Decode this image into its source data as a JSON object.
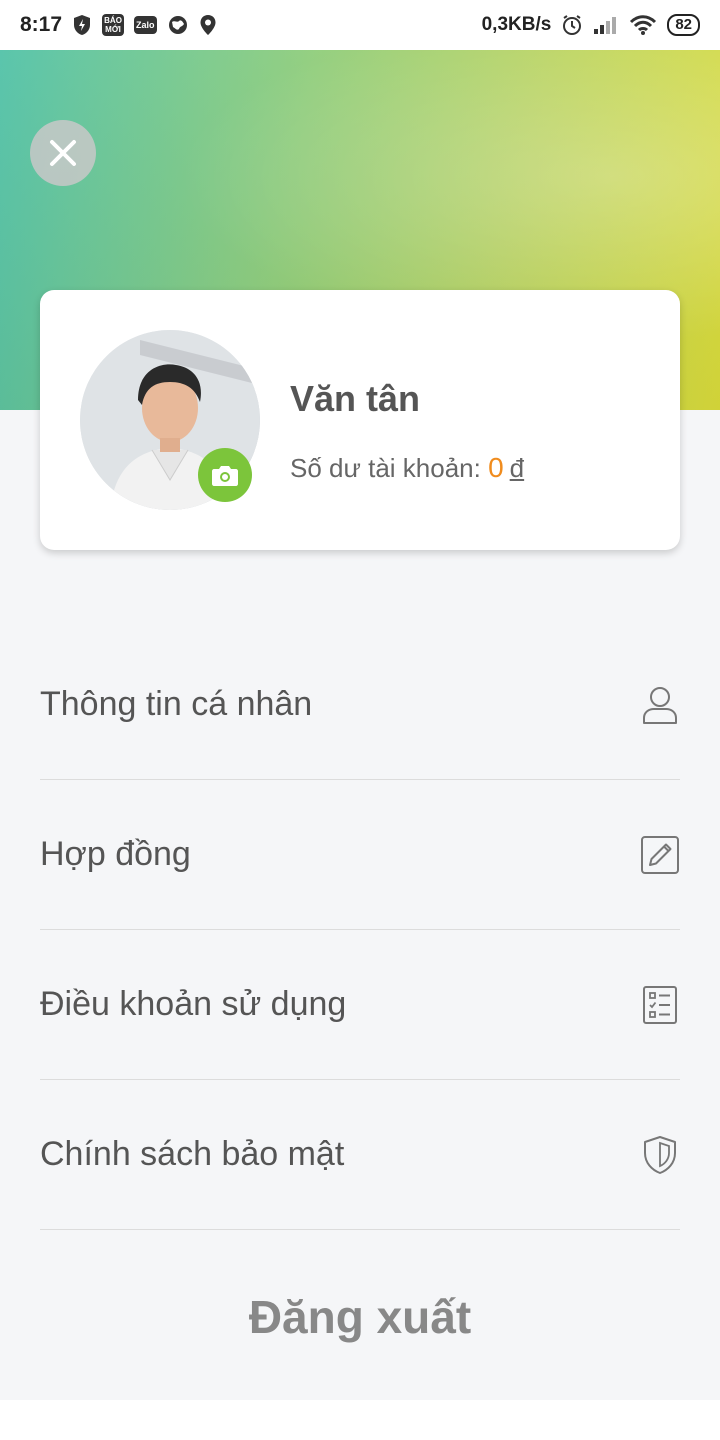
{
  "status_bar": {
    "time": "8:17",
    "bao_moi_label": "BÁO MỚI",
    "zalo_label": "Zalo",
    "network_speed": "0,3KB/s",
    "battery": "82"
  },
  "header": {
    "gradient_start": "#52c2a8",
    "gradient_end": "#d9db3a"
  },
  "profile": {
    "name": "Văn tân",
    "balance_label": "Số dư tài khoản: ",
    "balance_value": "0",
    "currency": "đ",
    "accent_color": "#7cc53b",
    "balance_color": "#f08c1e"
  },
  "menu": {
    "items": [
      {
        "label": "Thông tin cá nhân",
        "icon": "user-icon"
      },
      {
        "label": "Hợp đồng",
        "icon": "edit-icon"
      },
      {
        "label": "Điều khoản sử dụng",
        "icon": "checklist-icon"
      },
      {
        "label": "Chính sách bảo mật",
        "icon": "shield-icon"
      }
    ]
  },
  "logout_label": "Đăng xuất"
}
